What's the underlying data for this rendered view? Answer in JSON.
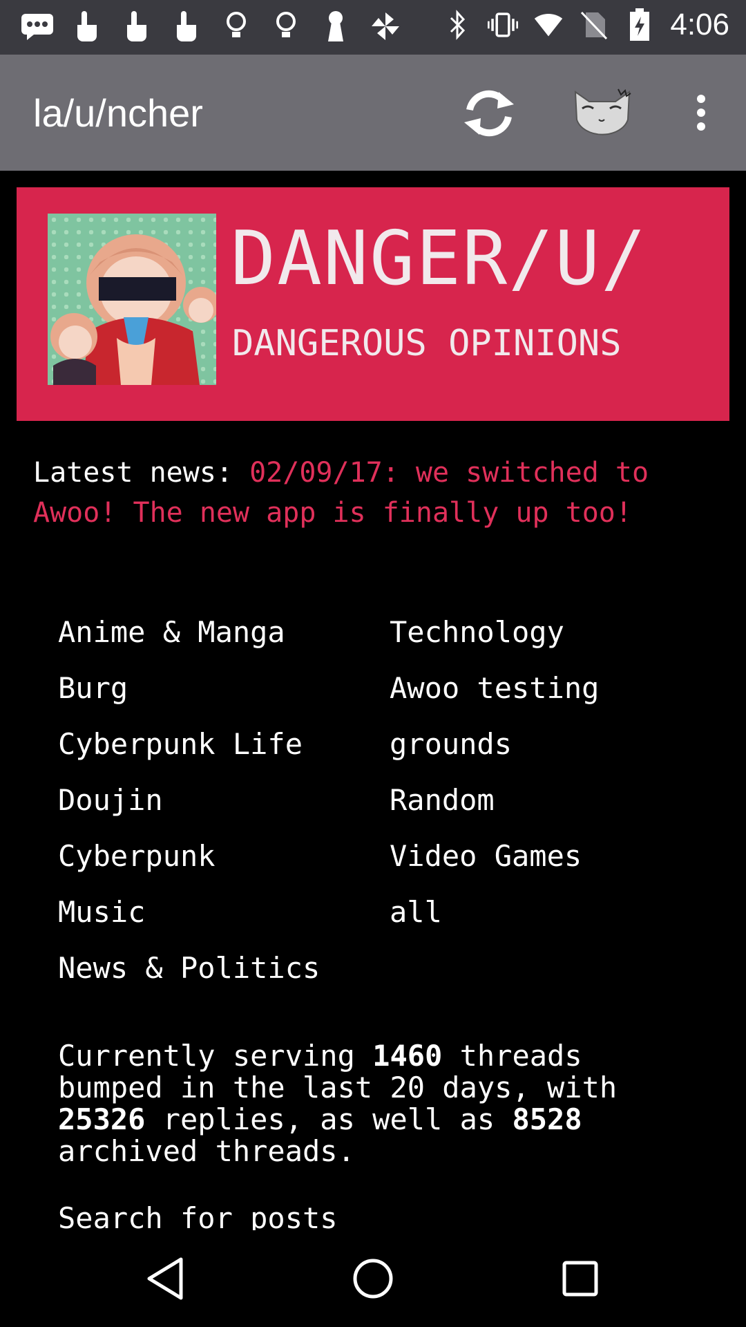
{
  "status_bar": {
    "time": "4:06",
    "left_icons": [
      "message-icon",
      "touch-icon",
      "touch-icon",
      "touch-icon",
      "bulb-icon",
      "bulb-icon",
      "keyhole-icon",
      "pinwheel-icon"
    ],
    "right_icons": [
      "bluetooth-icon",
      "vibrate-icon",
      "wifi-icon",
      "no-sim-icon",
      "battery-charging-icon"
    ]
  },
  "app_bar": {
    "title": "la/u/ncher",
    "actions": [
      "refresh-icon",
      "board-avatar",
      "overflow-menu-icon"
    ]
  },
  "banner": {
    "title": "DANGER/U/",
    "subtitle": "DANGEROUS OPINIONS",
    "accent": "#d7254d"
  },
  "news": {
    "label": "Latest news:",
    "text": "02/09/17: we switched to Awoo! The new app is finally up too!",
    "color": "#e0305a"
  },
  "boards": [
    {
      "label": "Anime & Manga"
    },
    {
      "label": "Technology"
    },
    {
      "label": "Burg"
    },
    {
      "label": "Awoo testing"
    },
    {
      "label": "Cyberpunk Life"
    },
    {
      "label": "grounds"
    },
    {
      "label": "Doujin"
    },
    {
      "label": "Random"
    },
    {
      "label": "Cyberpunk"
    },
    {
      "label": "Video Games"
    },
    {
      "label": "Music"
    },
    {
      "label": "all"
    },
    {
      "label": "News & Politics"
    }
  ],
  "stats": {
    "prefix": "Currently serving",
    "threads": "1460",
    "mid1": "threads bumped in the last 20 days, with",
    "replies": "25326",
    "mid2": "replies, as well as",
    "archived": "8528",
    "suffix": "archived threads."
  },
  "search": {
    "label": "Search for posts"
  },
  "nav_bar": {
    "buttons": [
      "back-icon",
      "home-icon",
      "recent-apps-icon"
    ]
  }
}
